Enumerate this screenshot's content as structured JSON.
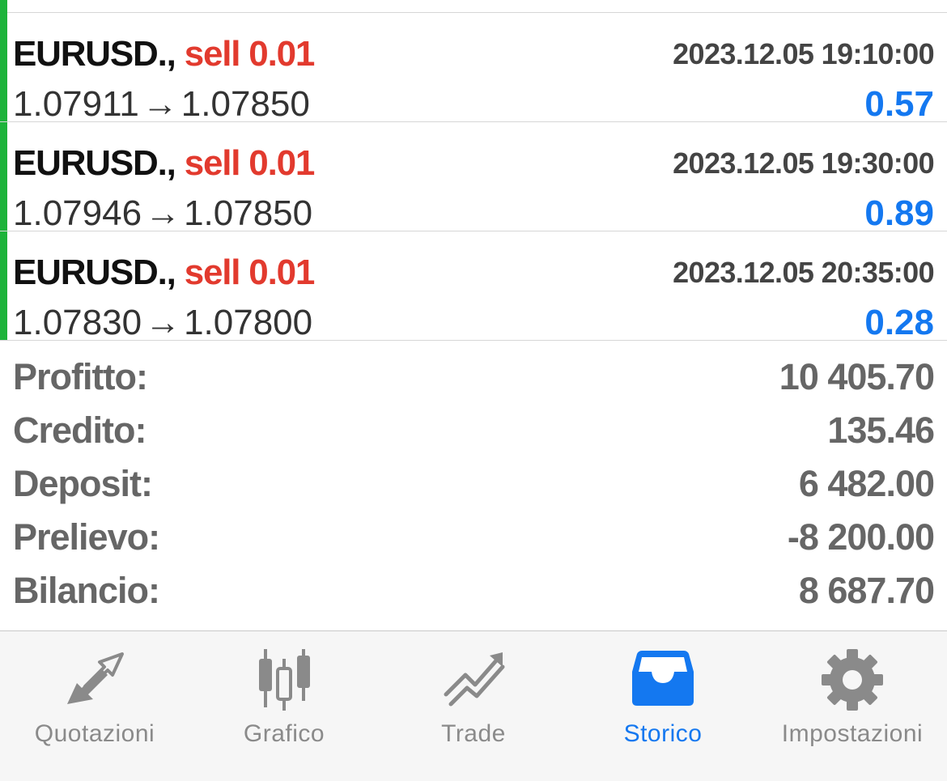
{
  "deals": [
    {
      "symbol": "EURUSD.,",
      "side": "sell 0.01",
      "time": "2023.12.05 19:10:00",
      "open_price": "1.07911",
      "arrow": "→",
      "close_price": "1.07850",
      "profit": "0.57"
    },
    {
      "symbol": "EURUSD.,",
      "side": "sell 0.01",
      "time": "2023.12.05 19:30:00",
      "open_price": "1.07946",
      "arrow": "→",
      "close_price": "1.07850",
      "profit": "0.89"
    },
    {
      "symbol": "EURUSD.,",
      "side": "sell 0.01",
      "time": "2023.12.05 20:35:00",
      "open_price": "1.07830",
      "arrow": "→",
      "close_price": "1.07800",
      "profit": "0.28"
    }
  ],
  "summary": {
    "profit_label": "Profitto:",
    "profit_value": "10 405.70",
    "credit_label": "Credito:",
    "credit_value": "135.46",
    "deposit_label": "Deposit:",
    "deposit_value": "6 482.00",
    "withdrawal_label": "Prelievo:",
    "withdrawal_value": "-8 200.00",
    "balance_label": "Bilancio:",
    "balance_value": "8 687.70"
  },
  "tabbar": {
    "tabs": [
      {
        "label": "Quotazioni",
        "icon": "quotes-arrows-icon",
        "active": false
      },
      {
        "label": "Grafico",
        "icon": "candlestick-chart-icon",
        "active": false
      },
      {
        "label": "Trade",
        "icon": "trade-trend-icon",
        "active": false
      },
      {
        "label": "Storico",
        "icon": "history-tray-icon",
        "active": true
      },
      {
        "label": "Impostazioni",
        "icon": "gear-icon",
        "active": false
      }
    ]
  },
  "colors": {
    "buy_accent": "#1db33a",
    "sell_text": "#e23a2e",
    "profit_text": "#1478f0",
    "active_tab": "#1478f0",
    "inactive_tab": "#8a8a8a"
  }
}
